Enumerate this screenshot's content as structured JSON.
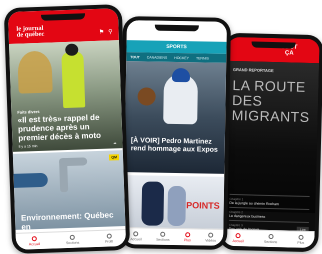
{
  "phone3": {
    "logo": "TOUT\nÇA",
    "kicker": "GRAND REPORTAGE",
    "title_lines": [
      "LA ROUTE",
      "DES",
      "MIGRANTS"
    ],
    "chapters": [
      {
        "label": "Chapitre 1",
        "title": "De la jungle au chemin Roxham"
      },
      {
        "label": "Chapitre 2",
        "title": "Le dangereux business"
      },
      {
        "label": "Chapitre 3",
        "title": "Des voix de l'espoir"
      }
    ],
    "cta": "Lire",
    "nav": [
      "Accueil",
      "Sections",
      "Plus"
    ]
  },
  "phone2": {
    "section_title": "SPORTS",
    "tabs": [
      "TOUT",
      "CANADIENS",
      "HOCKEY",
      "TENNIS"
    ],
    "headline": "[À VOIR] Pedro Martinez rend hommage aux Expos",
    "points_text": "POINTS",
    "nav": [
      "Accueil",
      "Sections",
      "Plus",
      "Vidéos"
    ]
  },
  "phone1": {
    "logo_line1": "le journal",
    "logo_line2": "de québec",
    "category": "Faits divers",
    "headline": "«Il est très» rappel de prudence après un premier décès à moto",
    "meta_left": "Il y a 15 min",
    "badge": "QM",
    "headline2": "Environnement: Québec en",
    "nav": [
      "Accueil",
      "Sections",
      "Profil"
    ]
  }
}
